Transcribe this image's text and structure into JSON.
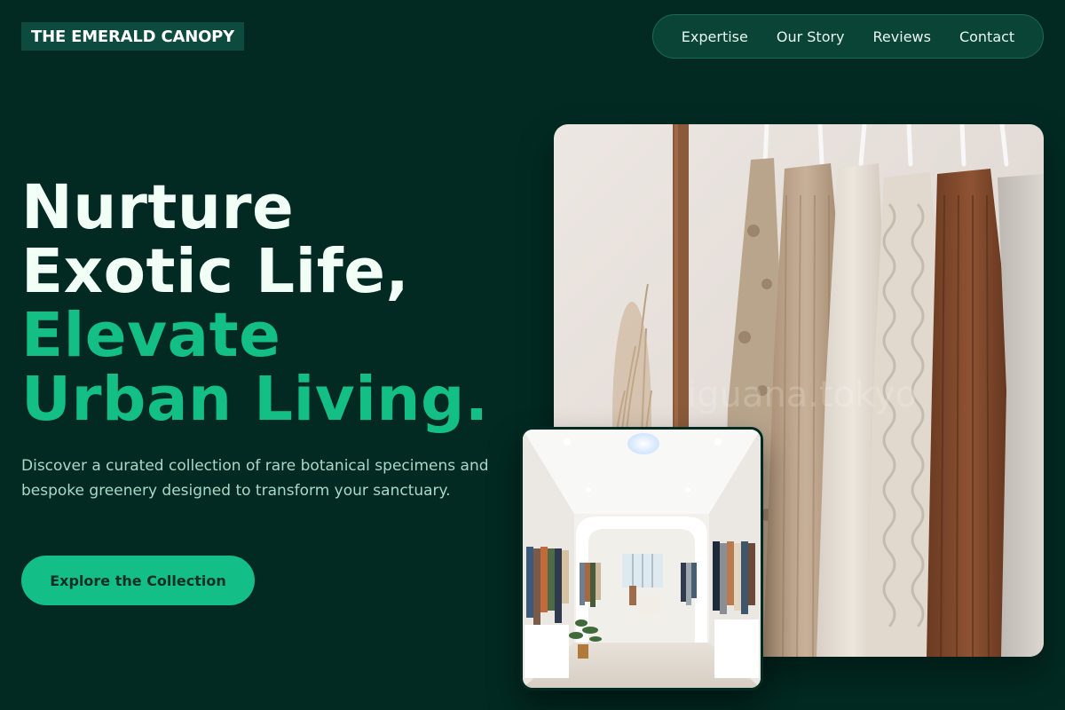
{
  "brand": {
    "name": "THE EMERALD CANOPY"
  },
  "nav": {
    "items": [
      {
        "label": "Expertise"
      },
      {
        "label": "Our Story"
      },
      {
        "label": "Reviews"
      },
      {
        "label": "Contact"
      }
    ]
  },
  "hero": {
    "headline_line1": "Nurture",
    "headline_line2": "Exotic Life,",
    "headline_line3": "Elevate",
    "headline_line4": "Urban Living.",
    "description": "Discover a curated collection of rare botanical specimens and bespoke greenery designed to transform your sanctuary.",
    "cta_label": "Explore the Collection",
    "main_image_alt": "clothing-rack-photo",
    "secondary_image_alt": "boutique-interior-photo"
  },
  "colors": {
    "background": "#022a22",
    "accent": "#14bf86",
    "nav_bg": "#0a4437"
  }
}
